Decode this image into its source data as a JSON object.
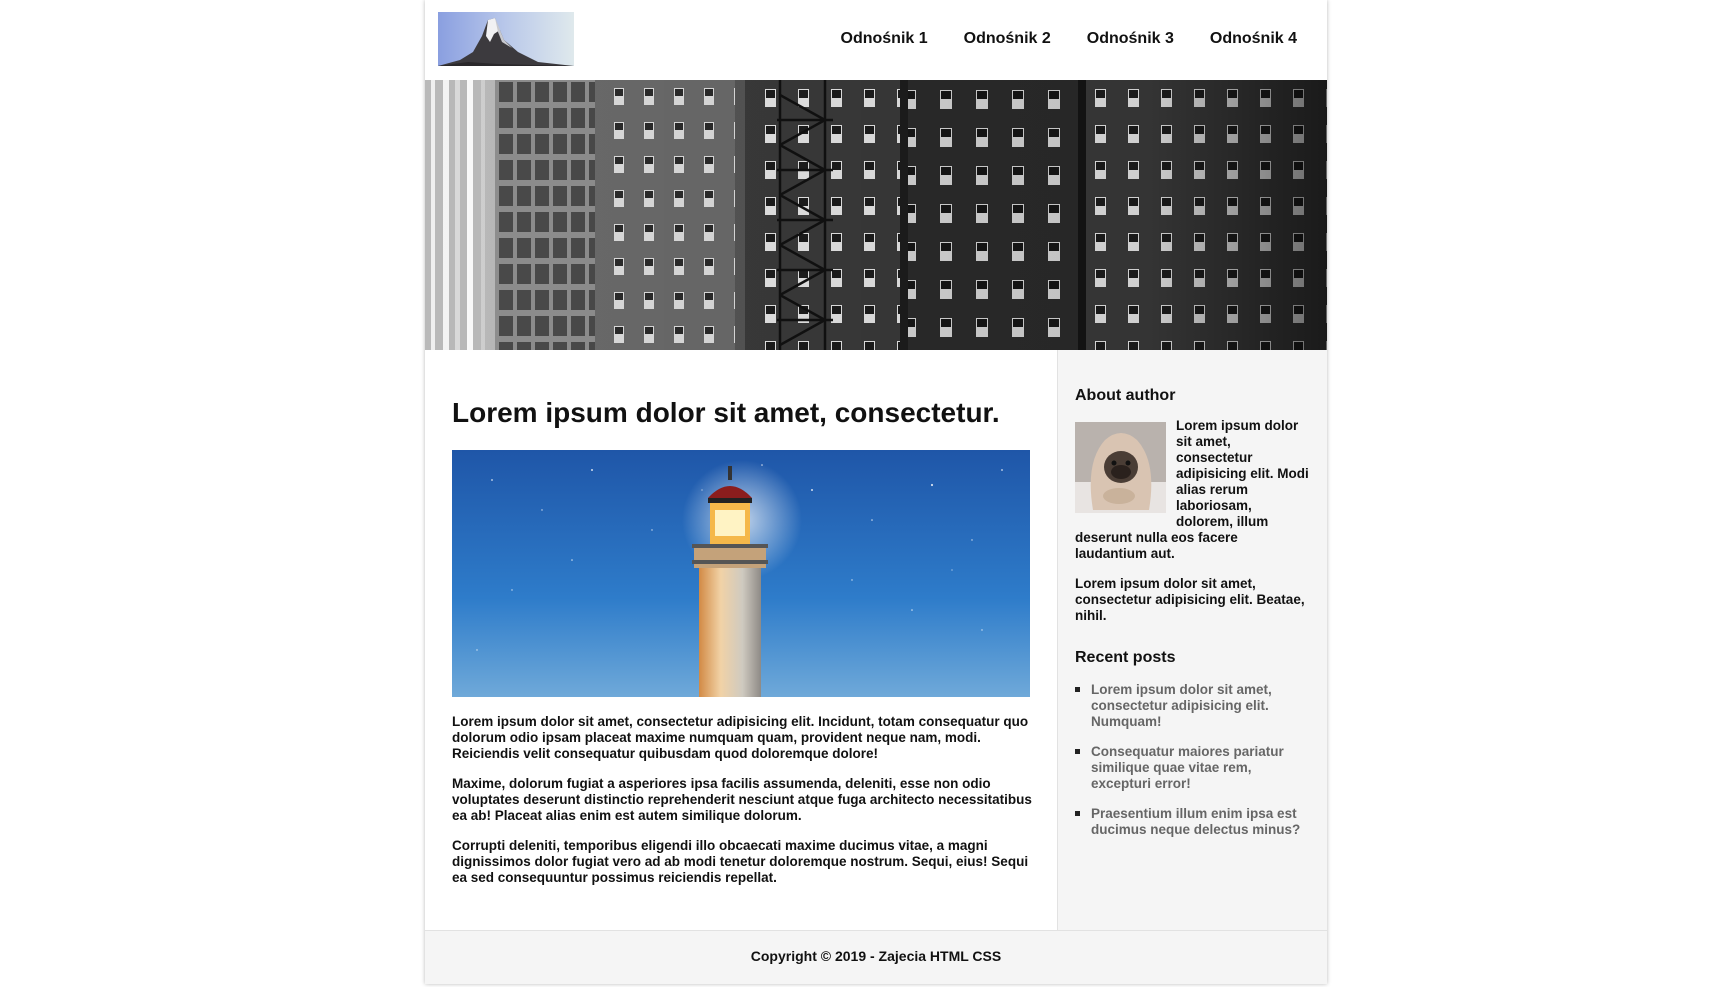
{
  "header": {
    "logo_alt": "mountain-logo",
    "nav": [
      {
        "label": "Odnośnik 1"
      },
      {
        "label": "Odnośnik 2"
      },
      {
        "label": "Odnośnik 3"
      },
      {
        "label": "Odnośnik 4"
      }
    ]
  },
  "hero": {
    "image": "black-and-white-city-buildings"
  },
  "post": {
    "title": "Lorem ipsum dolor sit amet, consectetur.",
    "image": "lighthouse-night-sky",
    "paragraphs": [
      "Lorem ipsum dolor sit amet, consectetur adipisicing elit. Incidunt, totam consequatur quo dolorum odio ipsam placeat maxime numquam quam, provident neque nam, modi. Reiciendis velit consequatur quibusdam quod doloremque dolore!",
      "Maxime, dolorum fugiat a asperiores ipsa facilis assumenda, deleniti, esse non odio voluptates deserunt distinctio reprehenderit nesciunt atque fuga architecto necessitatibus ea ab! Placeat alias enim est autem similique dolorum.",
      "Corrupti deleniti, temporibus eligendi illo obcaecati maxime ducimus vitae, a magni dignissimos dolor fugiat vero ad ab modi tenetur doloremque nostrum. Sequi, eius! Sequi ea sed consequuntur possimus reiciendis repellat."
    ]
  },
  "sidebar": {
    "about": {
      "heading": "About author",
      "avatar": "pug-in-blanket",
      "text1": "Lorem ipsum dolor sit amet, consectetur adipisicing elit. Modi alias rerum laboriosam, dolorem, illum deserunt nulla eos facere laudantium aut.",
      "text2": "Lorem ipsum dolor sit amet, consectetur adipisicing elit. Beatae, nihil."
    },
    "recent": {
      "heading": "Recent posts",
      "items": [
        {
          "label": "Lorem ipsum dolor sit amet, consectetur adipisicing elit. Numquam!"
        },
        {
          "label": "Consequatur maiores pariatur similique quae vitae rem, excepturi error!"
        },
        {
          "label": "Praesentium illum enim ipsa est ducimus neque delectus minus?"
        }
      ]
    }
  },
  "footer": {
    "copyright": "Copyright © 2019 - Zajecia HTML CSS"
  }
}
